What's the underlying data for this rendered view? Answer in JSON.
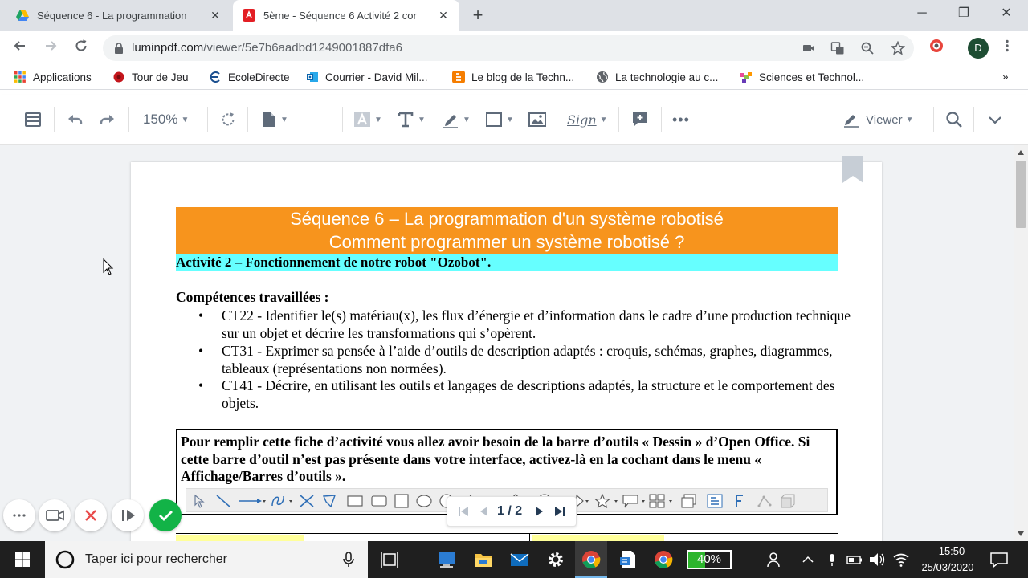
{
  "tabs": [
    {
      "title": "Séquence 6 - La programmation",
      "close": "✕"
    },
    {
      "title": "5ème - Séquence 6 Activité 2 cor",
      "close": "✕"
    }
  ],
  "new_tab": "+",
  "window": {
    "minimize": "─",
    "maximize": "❐",
    "close": "✕"
  },
  "address": {
    "host": "luminpdf.com",
    "path": "/viewer/5e7b6aadbd1249001887dfa6"
  },
  "profile_initial": "D",
  "bookmarks": [
    "Applications",
    "Tour de Jeu",
    "EcoleDirecte",
    "Courrier - David Mil...",
    "Le blog de la Techn...",
    "La technologie au c...",
    "Sciences et Technol..."
  ],
  "bookmarks_more": "»",
  "toolbar": {
    "zoom": "150%",
    "viewer_mode": "Viewer",
    "sign_label": "Sign",
    "more": "•••"
  },
  "colors": {
    "banner": "#f7941d",
    "activity_band": "#66ffff",
    "recorder_ok": "#12b347",
    "recorder_cancel": "#e94b4b",
    "battery": "#2db52d"
  },
  "document": {
    "title_line1": "Séquence 6 – La programmation d'un système robotisé",
    "title_line2": "Comment programmer un système robotisé ?",
    "activity": "Activité 2 – Fonctionnement de notre robot \"Ozobot\".",
    "competences_heading": "Compétences travaillées :",
    "bullet": "•",
    "competences": [
      "CT22 - Identifier le(s) matériau(x), les flux d’énergie et d’information dans le cadre d’une production technique sur un objet et décrire les transformations qui s’opèrent.",
      "CT31 - Exprimer sa pensée à l’aide d’outils de description adaptés : croquis, schémas, graphes, diagrammes, tableaux (représentations non normées).",
      "CT41 - Décrire, en utilisant les outils et langages de descriptions adaptés, la structure et le comportement des objets."
    ],
    "note": "Pour remplir cette fiche d’activité vous allez avoir besoin de la barre d’outils « Dessin » d’Open Office. Si cette barre d’outil n’est pas présente dans votre interface, activez-là en la cochant dans le menu « Affichage/Barres d’outils »."
  },
  "pagination": {
    "label": "1 / 2"
  },
  "taskbar": {
    "search_placeholder": "Taper ici pour rechercher",
    "battery_label": "40%",
    "battery_level_percent": 40,
    "time": "15:50",
    "date": "25/03/2020"
  }
}
